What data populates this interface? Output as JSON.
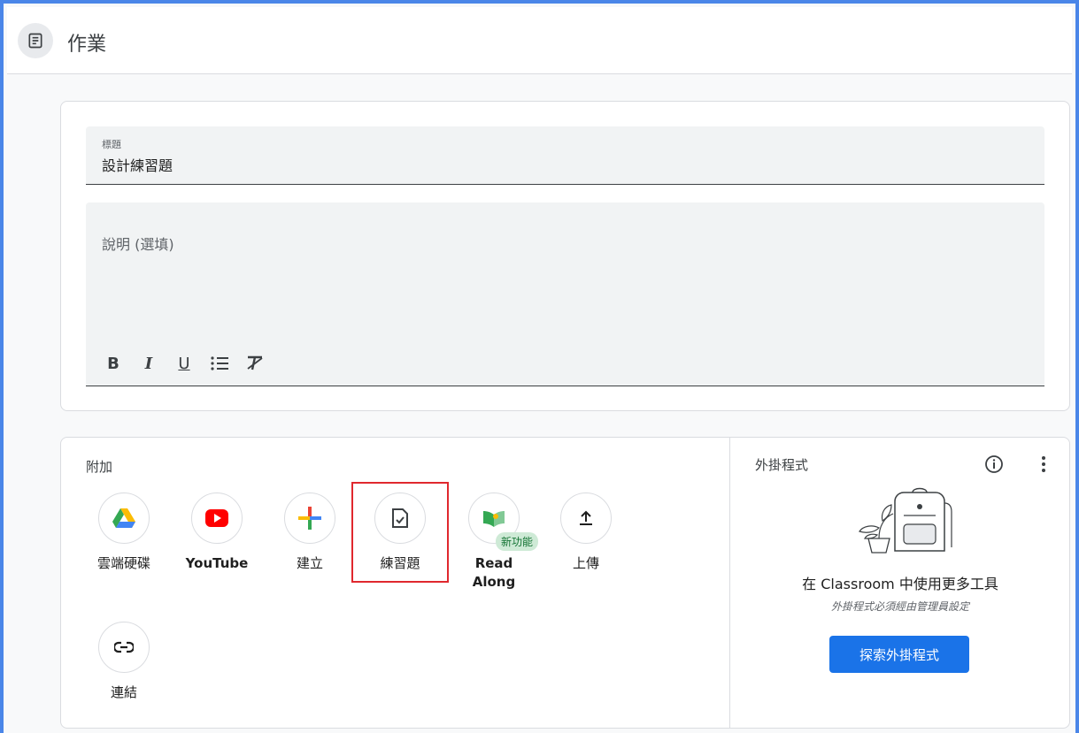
{
  "header": {
    "title": "作業"
  },
  "form": {
    "title_label": "標題",
    "title_value": "設計練習題",
    "description_placeholder": "說明 (選填)",
    "format_buttons": [
      "B",
      "I",
      "U"
    ]
  },
  "attach": {
    "label": "附加",
    "items": [
      {
        "label": "雲端硬碟",
        "icon": "google-drive-icon"
      },
      {
        "label": "YouTube",
        "icon": "youtube-icon"
      },
      {
        "label": "建立",
        "icon": "plus-icon"
      },
      {
        "label": "練習題",
        "icon": "practice-set-icon"
      },
      {
        "label": "Read Along",
        "icon": "read-along-icon",
        "badge": "新功能"
      },
      {
        "label": "上傳",
        "icon": "upload-icon"
      },
      {
        "label": "連結",
        "icon": "link-icon"
      }
    ]
  },
  "addons": {
    "title": "外掛程式",
    "heading": "在 Classroom 中使用更多工具",
    "subtext": "外掛程式必須經由管理員設定",
    "button_label": "探索外掛程式"
  },
  "colors": {
    "accent": "#1a73e8",
    "highlight": "#e0282e",
    "frame": "#4a86e8"
  }
}
